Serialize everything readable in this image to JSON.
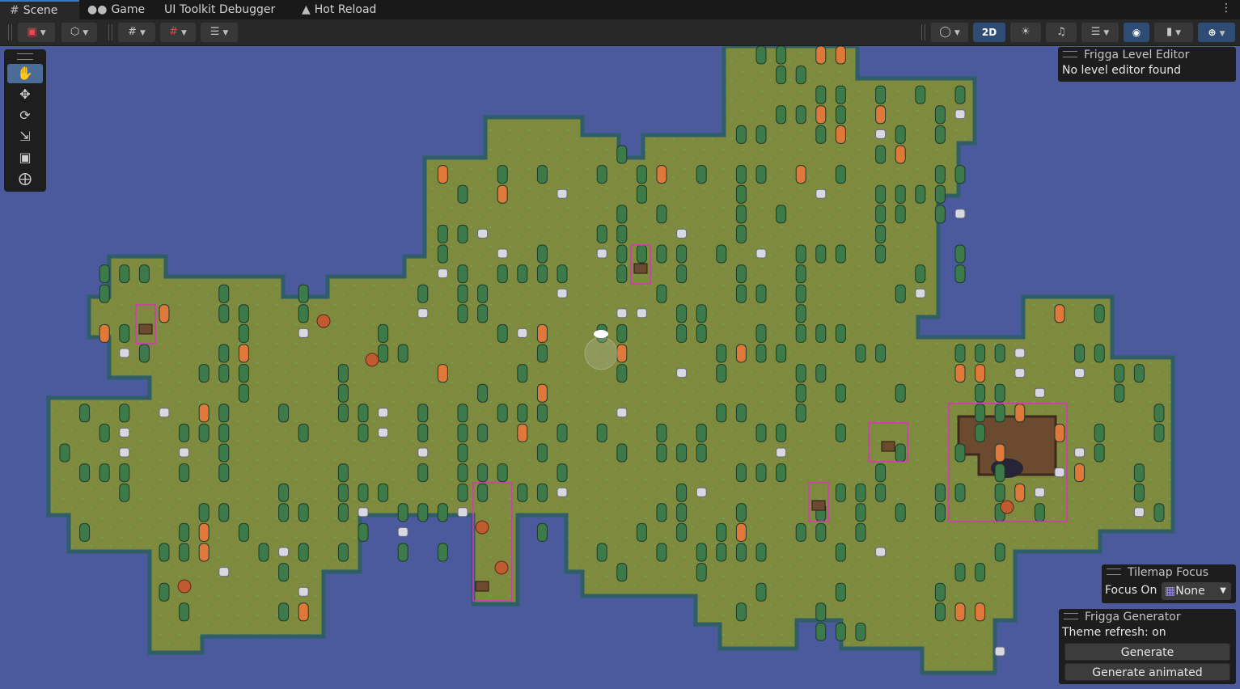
{
  "tabs": [
    {
      "label": "Scene",
      "icon": "grid-icon"
    },
    {
      "label": "Game",
      "icon": "gamepad-icon"
    },
    {
      "label": "UI Toolkit Debugger",
      "icon": ""
    },
    {
      "label": "Hot Reload",
      "icon": "hot-reload-icon"
    }
  ],
  "toolbar": {
    "mode_2d": "2D"
  },
  "tools": [
    "hand-icon",
    "move-icon",
    "rotate-icon",
    "scale-icon",
    "rect-icon",
    "transform-icon"
  ],
  "level_editor": {
    "title": "Frigga Level Editor",
    "message": "No level editor found"
  },
  "tilemap_focus": {
    "title": "Tilemap Focus",
    "label": "Focus On",
    "value": "None"
  },
  "generator": {
    "title": "Frigga Generator",
    "status": "Theme refresh: on",
    "generate": "Generate",
    "generate_animated": "Generate animated"
  },
  "colors": {
    "water": "#4a5a9d",
    "grass": "#7e8a3e",
    "cliff": "#2c5e5e",
    "dirt": "#6b4a2f",
    "tree": "#3c7a4a",
    "tree_orange": "#e0783a",
    "highlight": "#e02ec8",
    "accent": "#3a79bb"
  }
}
